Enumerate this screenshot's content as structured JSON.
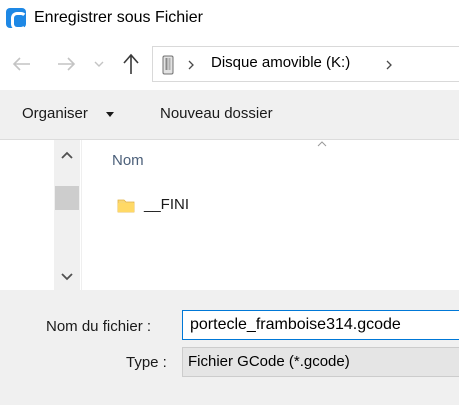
{
  "window": {
    "title": "Enregistrer sous Fichier",
    "app_icon": "app-logo-icon"
  },
  "navigation": {
    "back_icon": "arrow-left-icon",
    "forward_icon": "arrow-right-icon",
    "recent_icon": "chevron-down-icon",
    "up_icon": "arrow-up-icon",
    "address": {
      "drive_icon": "usb-drive-icon",
      "location": "Disque amovible (K:)"
    }
  },
  "toolbar": {
    "organise_label": "Organiser",
    "new_folder_label": "Nouveau dossier"
  },
  "file_list": {
    "column_header": "Nom",
    "items": [
      {
        "name": "__FINI",
        "icon": "folder-icon"
      }
    ]
  },
  "form": {
    "filename_label": "Nom du fichier :",
    "filename_value": "portecle_framboise314.gcode",
    "type_label": "Type :",
    "type_value": "Fichier GCode (*.gcode)"
  }
}
